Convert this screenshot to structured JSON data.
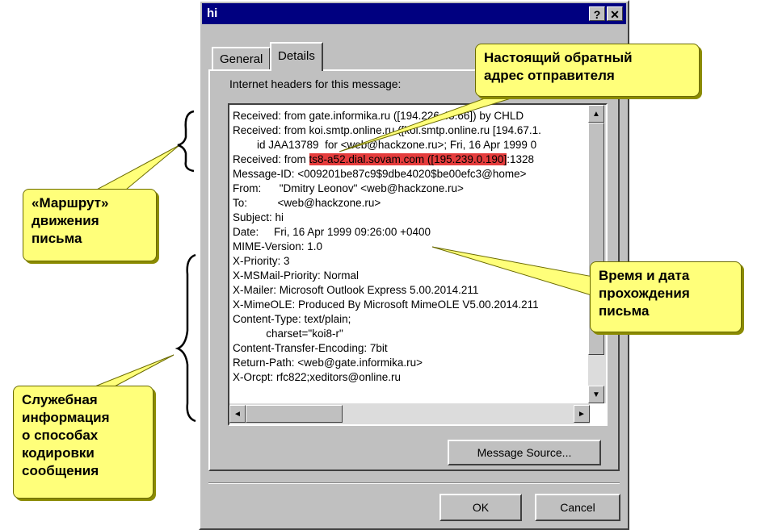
{
  "dialog": {
    "title": "hi",
    "help_button": "?",
    "close_button": "✕",
    "tabs": [
      "General",
      "Details"
    ],
    "headers_caption": "Internet headers for this message:",
    "headers": [
      "Received: from gate.informika.ru ([194.226.45.66]) by CHLD",
      "Received: from koi.smtp.online.ru ([koi.smtp.online.ru [194.67.1.",
      "        id JAA13789  for <web@hackzone.ru>; Fri, 16 Apr 1999 0",
      "Received: from ts8-a52.dial.sovam.com ([195.239.0.190]:1328",
      "Message-ID: <009201be87c9$9dbe4020$be00efc3@home>",
      "From:      \"Dmitry Leonov\" <web@hackzone.ru>",
      "To:          <web@hackzone.ru>",
      "Subject: hi",
      "Date:     Fri, 16 Apr 1999 09:26:00 +0400",
      "MIME-Version: 1.0",
      "X-Priority: 3",
      "X-MSMail-Priority: Normal",
      "X-Mailer: Microsoft Outlook Express 5.00.2014.211",
      "X-MimeOLE: Produced By Microsoft MimeOLE V5.00.2014.211",
      "Content-Type: text/plain;",
      "           charset=\"koi8-r\"",
      "Content-Transfer-Encoding: 7bit",
      "Return-Path: <web@gate.informika.ru>",
      "X-Orcpt: rfc822;xeditors@online.ru"
    ],
    "highlight_prefix": "Received: from ",
    "highlight_text": "ts8-a52.dial.sovam.com ([195.239.0.190]",
    "highlight_suffix": ":1328",
    "message_source_button": "Message Source...",
    "ok_button": "OK",
    "cancel_button": "Cancel"
  },
  "callouts": {
    "sender_address": "Настоящий обратный\nадрес отправителя",
    "route": "«Маршрут»\nдвижения\nписьма",
    "datetime": "Время и дата\nпрохождения\nписьма",
    "service_info": "Служебная\nинформация\nо способах\nкодировки\nсообщения"
  },
  "colors": {
    "callout_fill": "#ffff7a",
    "highlight": "#e53c3c",
    "titlebar": "#000080"
  }
}
